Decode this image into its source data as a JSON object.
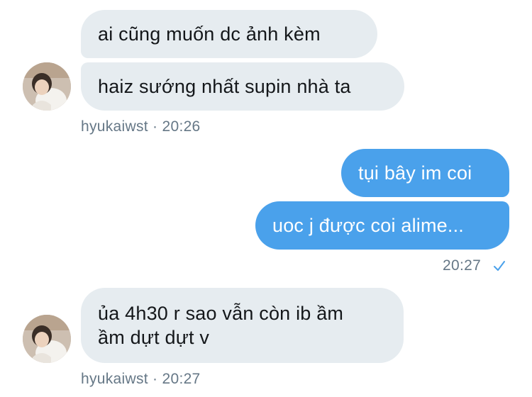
{
  "colors": {
    "incoming_bubble": "#e6ecf0",
    "outgoing_bubble": "#4aa1eb",
    "meta_text": "#657786",
    "read_check": "#4aa1eb"
  },
  "messages": {
    "group1": {
      "bubble1": "ai cũng muốn dc ảnh kèm",
      "bubble2": "haiz sướng nhất supin nhà ta",
      "sender": "hyukaiwst",
      "separator": "·",
      "time": "20:26"
    },
    "group2": {
      "bubble1": "tụi bây im coi",
      "bubble2": "uoc j được coi alime...",
      "time": "20:27",
      "read_icon": "check-icon"
    },
    "group3": {
      "bubble1_line1": "ủa 4h30 r sao vẫn còn ib ầm",
      "bubble1_line2": "ầm dựt dựt v",
      "sender": "hyukaiwst",
      "separator": "·",
      "time": "20:27"
    }
  }
}
